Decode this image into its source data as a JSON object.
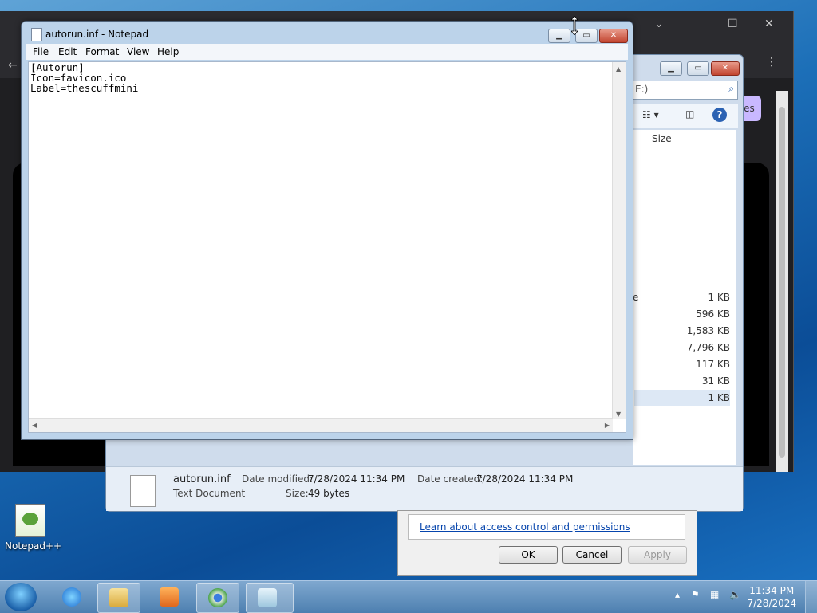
{
  "notepad": {
    "title": "autorun.inf - Notepad",
    "menu": [
      "File",
      "Edit",
      "Format",
      "View",
      "Help"
    ],
    "content": "[Autorun]\nIcon=favicon.ico\nLabel=thescuffmini"
  },
  "explorer": {
    "search_placeholder": "E:)",
    "size_header": "Size",
    "partial_row_text": "e",
    "sizes": [
      "1 KB",
      "596 KB",
      "1,583 KB",
      "7,796 KB",
      "117 KB",
      "31 KB",
      "1 KB"
    ],
    "details": {
      "filename": "autorun.inf",
      "type": "Text Document",
      "date_modified_label": "Date modified:",
      "date_modified": "7/28/2024 11:34 PM",
      "date_created_label": "Date created:",
      "date_created": "7/28/2024 11:34 PM",
      "size_label": "Size:",
      "size": "49 bytes"
    }
  },
  "properties_dialog": {
    "link": "Learn about access control and permissions",
    "ok": "OK",
    "cancel": "Cancel",
    "apply": "Apply"
  },
  "browser": {
    "pill_text": "es"
  },
  "desktop": {
    "icon_label": "Notepad++"
  },
  "taskbar": {
    "time": "11:34 PM",
    "date": "7/28/2024"
  }
}
